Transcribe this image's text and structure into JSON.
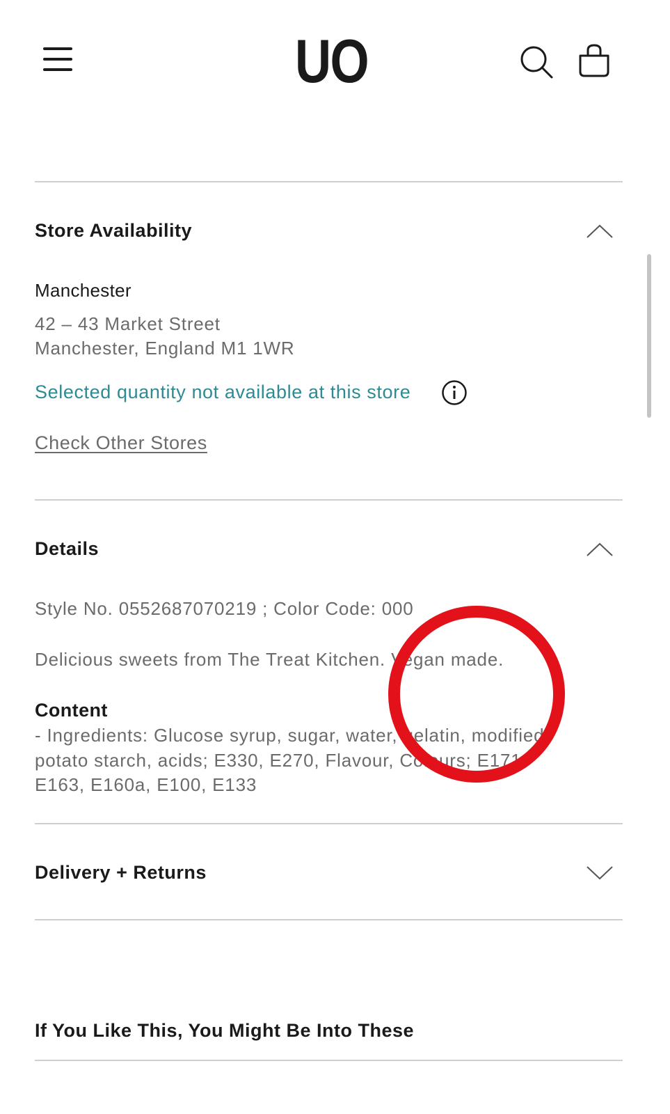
{
  "header": {
    "logo": "UO",
    "menu_icon": "hamburger-menu-icon",
    "search_icon": "search-icon",
    "bag_icon": "shopping-bag-icon"
  },
  "store_availability": {
    "title": "Store Availability",
    "expanded": true,
    "store_name": "Manchester",
    "address_line1": "42 – 43 Market Street",
    "address_line2": "Manchester, England M1 1WR",
    "availability_message": "Selected quantity not available at this store",
    "check_link": "Check Other Stores"
  },
  "details": {
    "title": "Details",
    "expanded": true,
    "style_line": "Style No. 0552687070219 ; Color Code: 000",
    "description": "Delicious sweets from The Treat Kitchen. Vegan made.",
    "content_title": "Content",
    "content_line1": "- Ingredients: Glucose syrup, sugar, water, gelatin, modified",
    "content_line2": "potato starch, acids; E330, E270, Flavour, Colours; E171,",
    "content_line3": "E163, E160a, E100, E133"
  },
  "delivery": {
    "title": "Delivery + Returns",
    "expanded": false
  },
  "recommendations": {
    "title": "If You Like This, You Might Be Into These"
  },
  "colors": {
    "accent_teal": "#2e8a93",
    "annotation_red": "#e3121a",
    "text_dark": "#1a1a1a",
    "text_grey": "#6b6b6b"
  }
}
